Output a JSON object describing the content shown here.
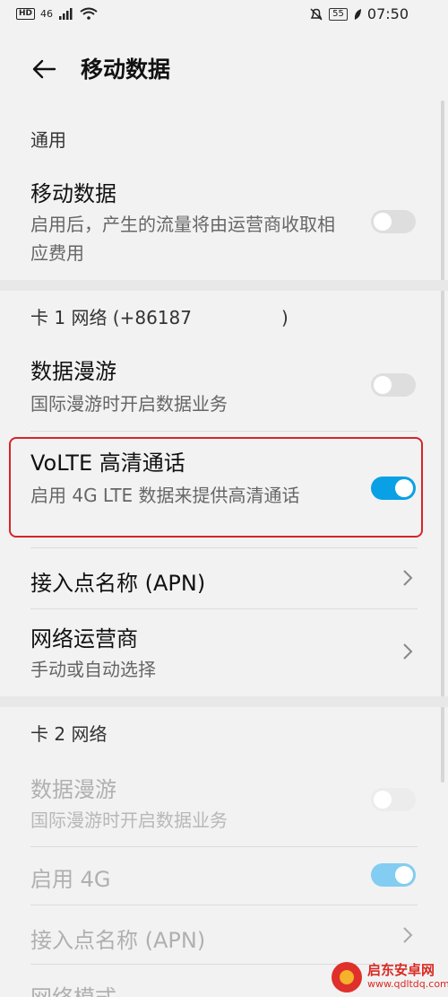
{
  "status_bar": {
    "left_badge": "HD",
    "network_type": "46",
    "battery_level": "55",
    "time": "07:50"
  },
  "header": {
    "title": "移动数据"
  },
  "general": {
    "header": "通用",
    "mobile_data": {
      "title": "移动数据",
      "subtitle": "启用后，产生的流量将由运营商收取相应费用",
      "enabled": false
    }
  },
  "sim1": {
    "header": "卡 1 网络 (+86187　　　　　)",
    "data_roaming": {
      "title": "数据漫游",
      "subtitle": "国际漫游时开启数据业务",
      "enabled": false
    },
    "volte": {
      "title": "VoLTE 高清通话",
      "subtitle": "启用 4G LTE 数据来提供高清通话",
      "enabled": true
    },
    "apn": {
      "title": "接入点名称 (APN)"
    },
    "carrier": {
      "title": "网络运营商",
      "subtitle": "手动或自动选择"
    }
  },
  "sim2": {
    "header": "卡 2 网络",
    "data_roaming": {
      "title": "数据漫游",
      "subtitle": "国际漫游时开启数据业务",
      "enabled": false
    },
    "enable_4g": {
      "title": "启用 4G",
      "enabled": true
    },
    "apn": {
      "title": "接入点名称 (APN)"
    },
    "network_mode": {
      "title": "网络模式"
    }
  },
  "watermark": {
    "name": "启东安卓网",
    "url": "www.qdltdq.com"
  },
  "colors": {
    "accent": "#0aa0e5",
    "highlight_border": "#d8232a"
  }
}
